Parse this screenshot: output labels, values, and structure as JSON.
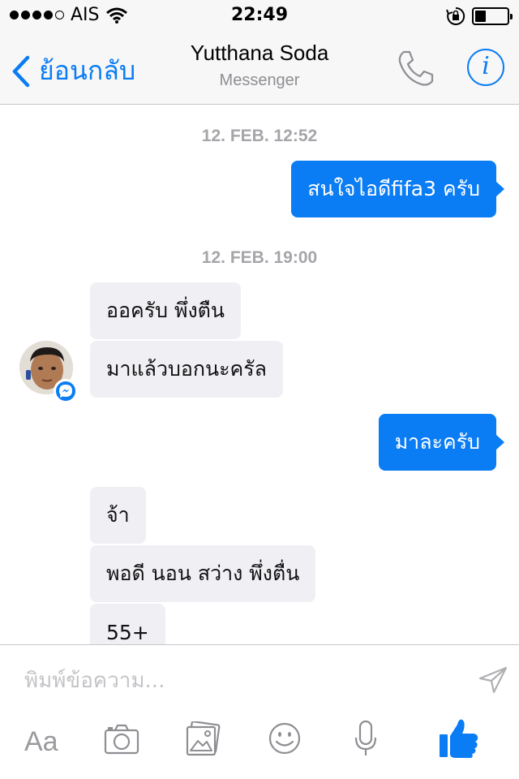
{
  "status_bar": {
    "carrier": "AIS",
    "time": "22:49",
    "battery_level": 0.35
  },
  "nav": {
    "back_label": "ย้อนกลับ",
    "title": "Yutthana Soda",
    "subtitle": "Messenger",
    "info_glyph": "i"
  },
  "chat": {
    "timestamps": [
      "12. FEB. 12:52",
      "12. FEB. 19:00"
    ],
    "messages": [
      {
        "from": "me",
        "text": "สนใจไอดีfifa3 ครับ"
      },
      {
        "from": "them",
        "text": "ออครับ พึ่งตืน"
      },
      {
        "from": "them",
        "text": "มาแล้วบอกนะครัล"
      },
      {
        "from": "me",
        "text": "มาละครับ"
      },
      {
        "from": "them",
        "text": "จ้า"
      },
      {
        "from": "them",
        "text": "พอดี นอน สว่าง พึ่งตื่น"
      },
      {
        "from": "them",
        "text": "55+"
      }
    ]
  },
  "composer": {
    "placeholder": "พิมพ์ข้อความ...",
    "value": "",
    "aa_label": "Aa"
  },
  "colors": {
    "accent": "#0a7cf4",
    "incoming_bubble": "#f0eff4",
    "timestamp": "#a5a5aa"
  },
  "icons": [
    "signal-dots-icon",
    "wifi-icon",
    "rotation-lock-icon",
    "battery-icon",
    "chevron-left-icon",
    "phone-icon",
    "info-icon",
    "messenger-badge-icon",
    "send-icon",
    "camera-icon",
    "photo-gallery-icon",
    "emoji-icon",
    "microphone-icon",
    "thumbs-up-icon"
  ]
}
